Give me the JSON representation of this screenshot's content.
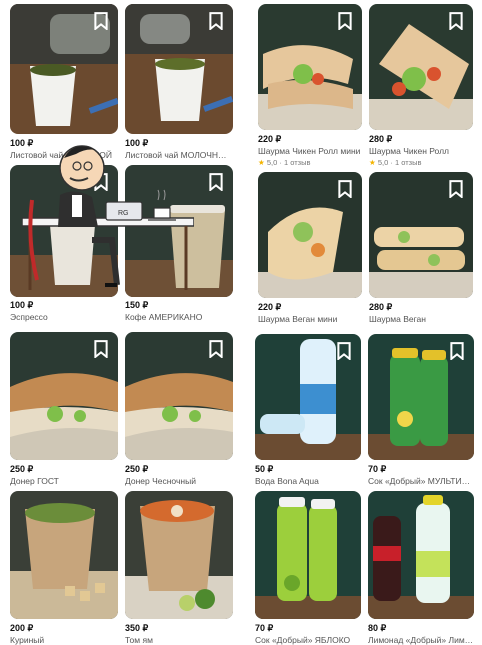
{
  "currency": "₽",
  "items": [
    {
      "price": "100 ₽",
      "name": "Листовой чай ТРАВЯНОЙ",
      "bg": "#6b4a2f",
      "accent": "#5a6a2a",
      "icon": "bookmark-icon"
    },
    {
      "price": "100 ₽",
      "name": "Листовой чай МОЛОЧНЫЙ УЛУН",
      "bg": "#6b4a2f",
      "accent": "#6a7a30",
      "icon": "bookmark-icon"
    },
    {
      "price": "220 ₽",
      "name": "Шаурма Чикен Ролл мини",
      "rating": "5,0",
      "reviews": "· 1 отзыв",
      "bg": "#2a3a30",
      "accent": "#d98a4a",
      "icon": "bookmark-icon"
    },
    {
      "price": "280 ₽",
      "name": "Шаурма Чикен Ролл",
      "rating": "5,0",
      "reviews": "· 1 отзыв",
      "bg": "#2a3a30",
      "accent": "#d98a4a",
      "icon": "bookmark-icon"
    },
    {
      "price": "100 ₽",
      "name": "Эспрессо",
      "bg": "#2e3b34",
      "accent": "#c9a27a",
      "icon": "bookmark-icon"
    },
    {
      "price": "150 ₽",
      "name": "Кофе АМЕРИКАНО",
      "bg": "#2e3b34",
      "accent": "#c9a27a",
      "icon": "bookmark-icon"
    },
    {
      "price": "220 ₽",
      "name": "Шаурма Веган мини",
      "bg": "#27352d",
      "accent": "#e8cf9a",
      "icon": "bookmark-icon"
    },
    {
      "price": "280 ₽",
      "name": "Шаурма Веган",
      "bg": "#27352d",
      "accent": "#e8cf9a",
      "icon": "bookmark-icon"
    },
    {
      "price": "250 ₽",
      "name": "Донер ГОСТ",
      "bg": "#2b3a33",
      "accent": "#b8743a",
      "icon": "bookmark-icon"
    },
    {
      "price": "250 ₽",
      "name": "Донер Чесночный",
      "bg": "#2b3a33",
      "accent": "#b8743a",
      "icon": "bookmark-icon"
    },
    {
      "price": "50 ₽",
      "name": "Вода Bona Aqua",
      "bg": "#1f4038",
      "accent": "#6ec3e8",
      "icon": "bookmark-icon"
    },
    {
      "price": "70 ₽",
      "name": "Сок «Добрый» МУЛЬТИФРУКТ",
      "bg": "#1f4038",
      "accent": "#e3c12a",
      "icon": "bookmark-icon"
    },
    {
      "price": "200 ₽",
      "name": "Куриный",
      "bg": "#3a3f37",
      "accent": "#c9b58a",
      "icon": "bookmark-icon"
    },
    {
      "price": "350 ₽",
      "name": "Том ям",
      "bg": "#3a3f37",
      "accent": "#d46a2e",
      "icon": "bookmark-icon"
    },
    {
      "price": "70 ₽",
      "name": "Сок «Добрый» ЯБЛОКО",
      "bg": "#1f4038",
      "accent": "#9ccf3c",
      "icon": "bookmark-icon"
    },
    {
      "price": "80 ₽",
      "name": "Лимонад «Добрый» Лимон-Лайм",
      "bg": "#1f4038",
      "accent": "#c4e25a",
      "icon": "bookmark-icon"
    }
  ],
  "overlay": {
    "laptop_label": "RG",
    "icon": "restaurant-owner-illustration"
  }
}
